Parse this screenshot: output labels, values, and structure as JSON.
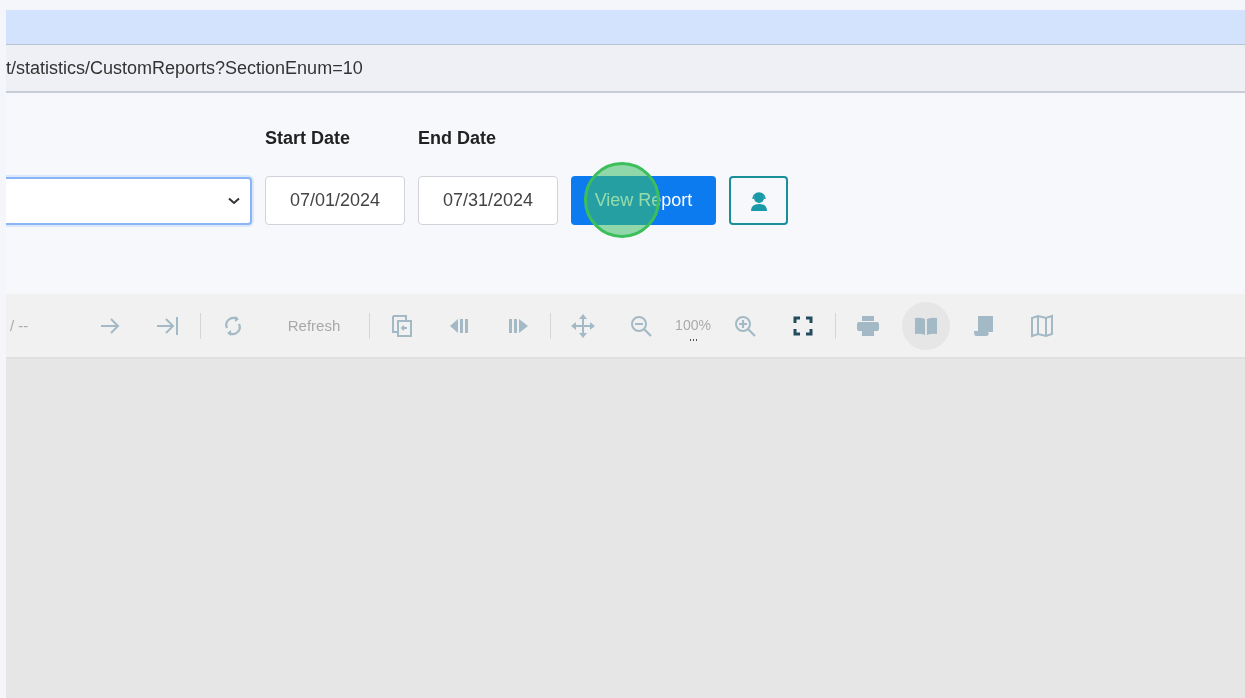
{
  "address_bar": {
    "url": "t/statistics/CustomReports?SectionEnum=10"
  },
  "filters": {
    "report_select": {
      "focused": true
    },
    "start_date": {
      "label": "Start Date",
      "value": "07/01/2024"
    },
    "end_date": {
      "label": "End Date",
      "value": "07/31/2024"
    },
    "view_button": {
      "label": "View Report",
      "click_marker": true
    }
  },
  "toolbar": [
    {
      "kind": "text",
      "text": "/ --"
    },
    {
      "kind": "icon",
      "disabled": true
    },
    {
      "kind": "icon",
      "disabled": true
    },
    {
      "kind": "divider"
    },
    {
      "kind": "icon",
      "disabled": true
    },
    {
      "kind": "label",
      "text": "Refresh"
    },
    {
      "kind": "divider"
    },
    {
      "kind": "icon",
      "disabled": true
    },
    {
      "kind": "icon",
      "disabled": true
    },
    {
      "kind": "icon",
      "disabled": true
    },
    {
      "kind": "divider"
    },
    {
      "kind": "icon",
      "disabled": true
    },
    {
      "kind": "icon",
      "disabled": true
    },
    {
      "kind": "zoom",
      "text": "100%"
    },
    {
      "kind": "icon",
      "disabled": true
    },
    {
      "kind": "icon",
      "disabled": false
    },
    {
      "kind": "divider"
    },
    {
      "kind": "icon",
      "disabled": true
    },
    {
      "kind": "icon",
      "disabled": true,
      "hovered": true
    },
    {
      "kind": "icon",
      "disabled": true
    },
    {
      "kind": "icon",
      "disabled": true
    }
  ]
}
